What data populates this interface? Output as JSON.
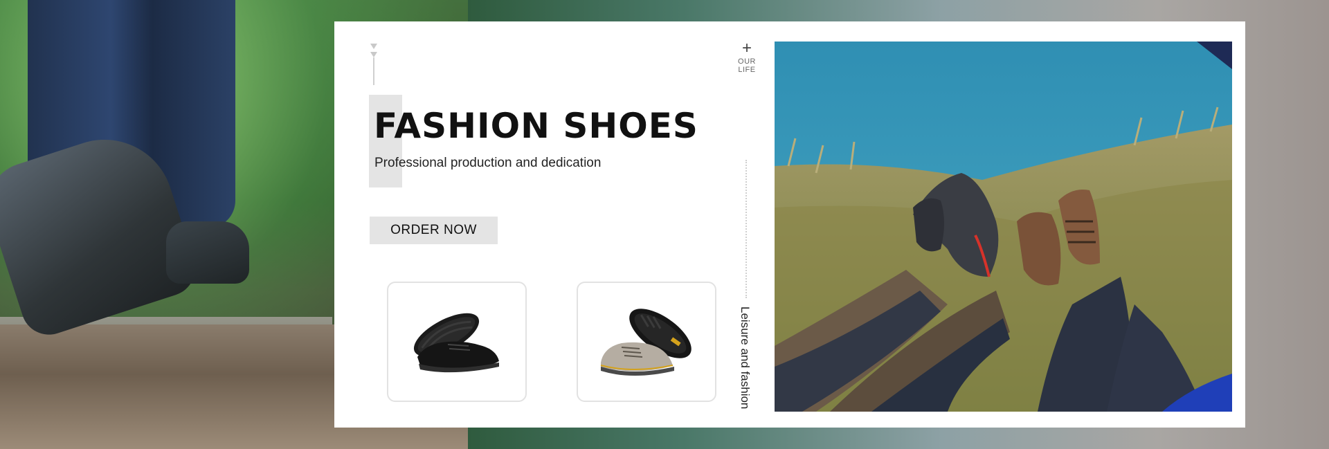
{
  "banner": {
    "title": "FASHION SHOES",
    "subtitle": "Professional production and dedication",
    "order_button_label": "ORDER NOW",
    "side_label_top": "OUR LIFE",
    "side_label_plus": "+",
    "side_label_vertical": "Leisure and fashion"
  },
  "products": [
    {
      "name": "black-sneaker",
      "color": "#1a1a1a"
    },
    {
      "name": "grey-safety-shoe",
      "color": "#a8a39a"
    }
  ],
  "colors": {
    "card_background": "#ffffff",
    "button_background": "#e4e4e4",
    "title_color": "#111111",
    "sea_color": "#3b8fae",
    "grass_color": "#8c8a52"
  }
}
